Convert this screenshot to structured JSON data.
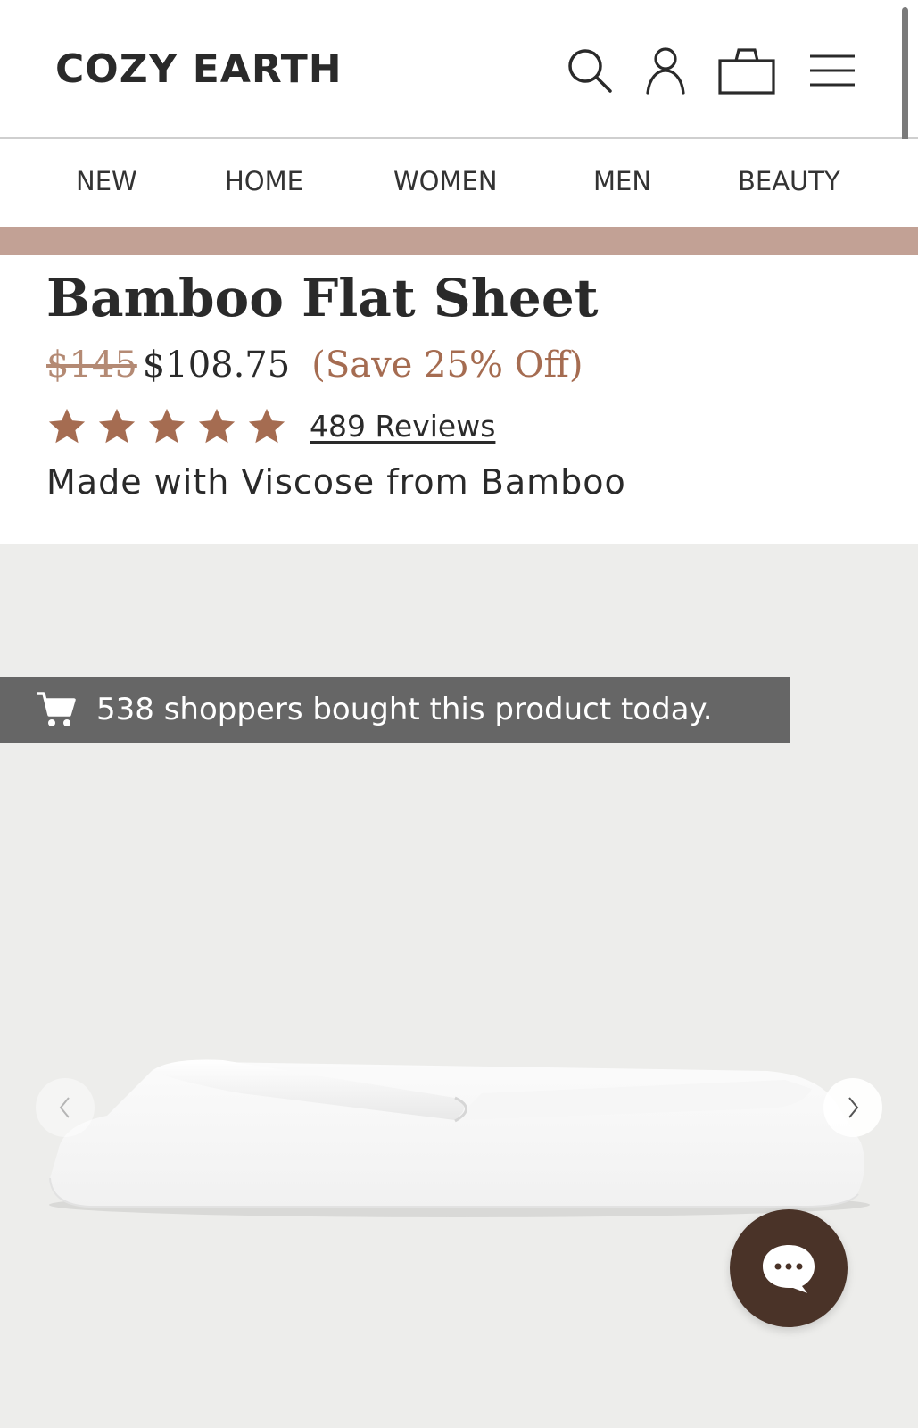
{
  "header": {
    "logo": "COZY EARTH",
    "icons": [
      "search-icon",
      "account-icon",
      "cart-icon",
      "menu-icon"
    ]
  },
  "nav": {
    "items": [
      "NEW",
      "HOME",
      "WOMEN",
      "MEN",
      "BEAUTY"
    ]
  },
  "product": {
    "title": "Bamboo Flat Sheet",
    "original_price": "$145",
    "sale_price": "$108.75",
    "savings": "(Save 25% Off)",
    "rating": 5,
    "reviews": "489 Reviews",
    "subtitle": "Made with Viscose from Bamboo"
  },
  "gallery": {
    "banner_text": "538 shoppers bought this product today."
  },
  "colors": {
    "accent": "#a56c51",
    "promo_bar": "#c2a195",
    "chat_button": "#4a3328",
    "gallery_bg": "#ededeb"
  }
}
